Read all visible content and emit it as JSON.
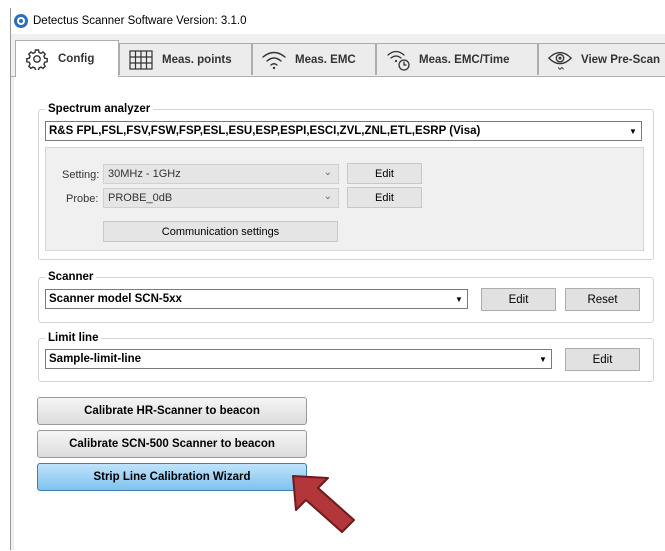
{
  "window": {
    "title": "Detectus Scanner Software Version: 3.1.0"
  },
  "tabs": [
    {
      "label": "Config",
      "icon": "gear-icon",
      "active": true
    },
    {
      "label": "Meas. points",
      "icon": "grid-icon"
    },
    {
      "label": "Meas. EMC",
      "icon": "wifi-icon"
    },
    {
      "label": "Meas. EMC/Time",
      "icon": "wifi-clock-icon"
    },
    {
      "label": "View Pre-Scan",
      "icon": "eye-icon"
    }
  ],
  "spectrum": {
    "legend": "Spectrum analyzer",
    "analyzer_value": "R&S FPL,FSL,FSV,FSW,FSP,ESL,ESU,ESP,ESPI,ESCI,ZVL,ZNL,ETL,ESRP (Visa)",
    "setting_label": "Setting:",
    "setting_value": "30MHz - 1GHz",
    "probe_label": "Probe:",
    "probe_value": "PROBE_0dB",
    "edit_label": "Edit",
    "comm_label": "Communication settings"
  },
  "scanner": {
    "legend": "Scanner",
    "model_value": "Scanner model SCN-5xx",
    "edit_label": "Edit",
    "reset_label": "Reset"
  },
  "limit": {
    "legend": "Limit line",
    "value": "Sample-limit-line",
    "edit_label": "Edit"
  },
  "actions": {
    "calib_hr": "Calibrate HR-Scanner to beacon",
    "calib_scn": "Calibrate SCN-500 Scanner to beacon",
    "strip_line": "Strip Line Calibration Wizard"
  },
  "colors": {
    "highlight_arrow": "#b2363a",
    "primary_button": "#7fc2ee"
  }
}
